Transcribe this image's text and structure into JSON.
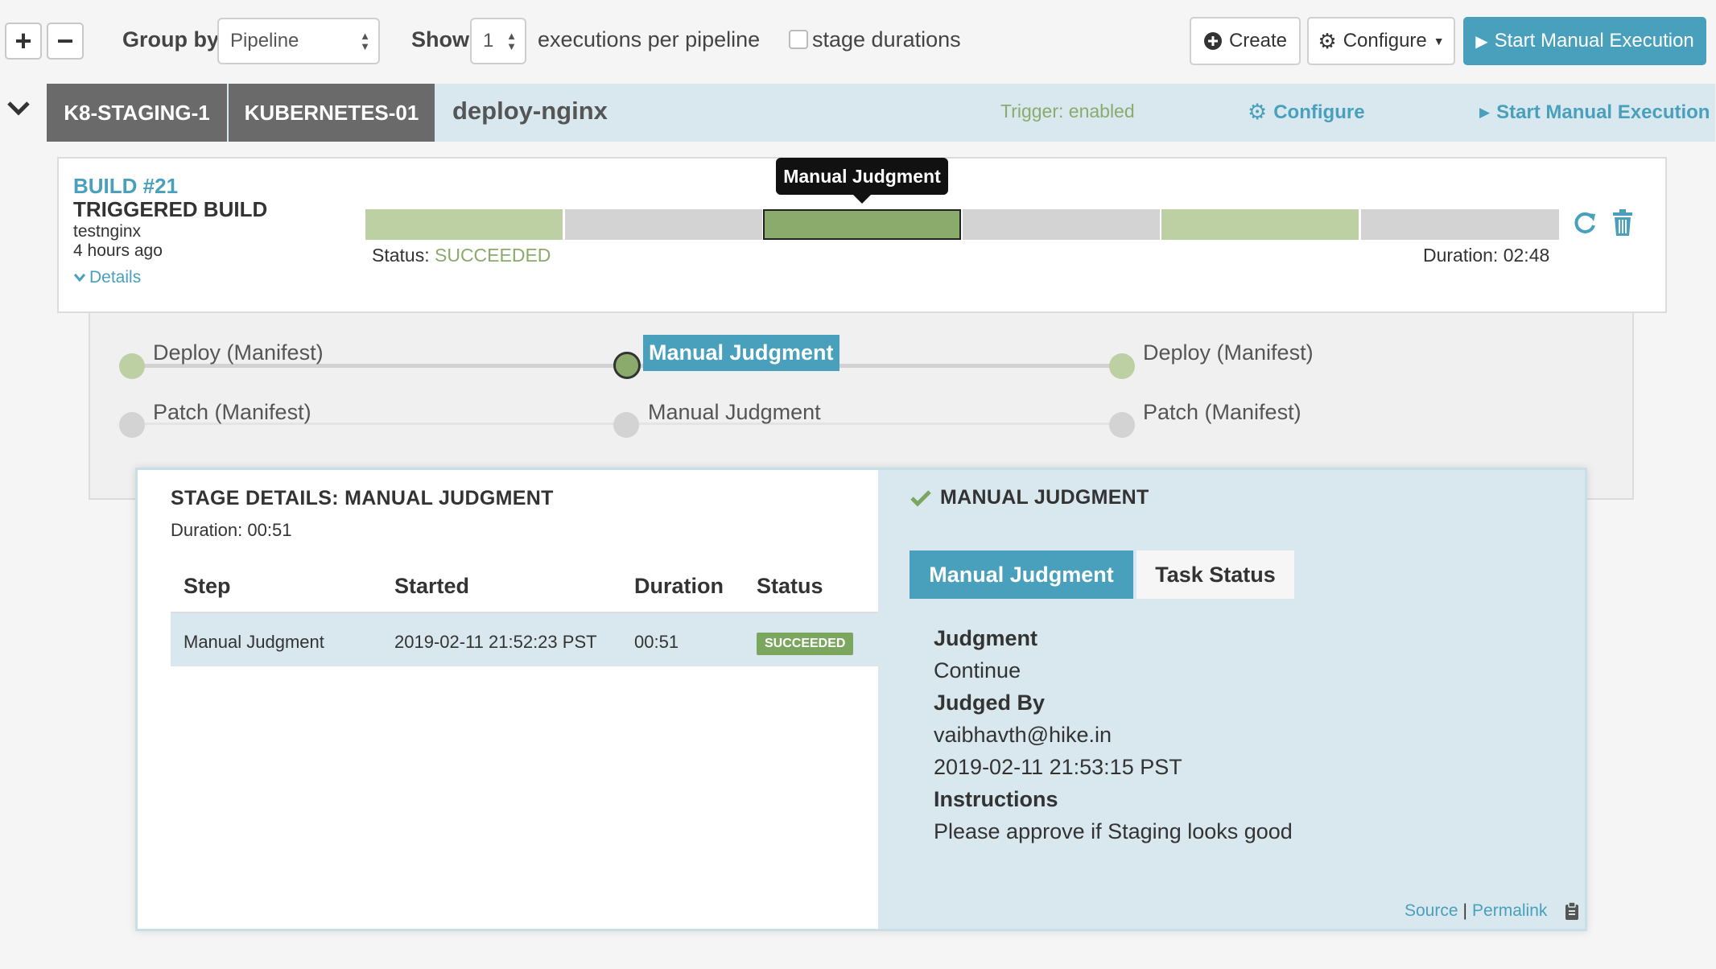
{
  "toolbar": {
    "expand_label": "+",
    "collapse_label": "−",
    "group_by_label": "Group by",
    "group_by_value": "Pipeline",
    "show_label": "Show",
    "show_value": "1",
    "per_pipeline_text": "executions per pipeline",
    "stage_durations_label": "stage durations",
    "create_label": "Create",
    "configure_label": "Configure",
    "start_label": "Start Manual Execution"
  },
  "pipeline": {
    "accounts": [
      "K8-STAGING-1",
      "KUBERNETES-01"
    ],
    "name": "deploy-nginx",
    "trigger_status": "Trigger: enabled",
    "configure_label": "Configure",
    "start_label": "Start Manual Execution"
  },
  "execution": {
    "build": "BUILD #21",
    "trigger": "TRIGGERED BUILD",
    "user": "testnginx",
    "time_ago": "4 hours ago",
    "details_label": "Details",
    "status_label": "Status:",
    "status_value": "SUCCEEDED",
    "duration": "Duration: 02:48",
    "tooltip": "Manual Judgment"
  },
  "stages": {
    "row1": [
      "Deploy (Manifest)",
      "Manual Judgment",
      "Deploy (Manifest)"
    ],
    "row2": [
      "Patch (Manifest)",
      "Manual Judgment",
      "Patch (Manifest)"
    ]
  },
  "stage_details": {
    "title": "STAGE DETAILS: MANUAL JUDGMENT",
    "duration": "Duration: 00:51",
    "columns": [
      "Step",
      "Started",
      "Duration",
      "Status"
    ],
    "rows": [
      {
        "step": "Manual Judgment",
        "started": "2019-02-11 21:52:23 PST",
        "duration": "00:51",
        "status": "SUCCEEDED"
      }
    ]
  },
  "judgment_panel": {
    "title": "MANUAL JUDGMENT",
    "tabs": [
      "Manual Judgment",
      "Task Status"
    ],
    "judgment_label": "Judgment",
    "judgment_value": "Continue",
    "judged_by_label": "Judged By",
    "judged_by_value": "vaibhavth@hike.in",
    "judged_at": "2019-02-11 21:53:15 PST",
    "instructions_label": "Instructions",
    "instructions_value": "Please approve if Staging looks good",
    "source_label": "Source",
    "separator": "|",
    "permalink_label": "Permalink"
  },
  "colors": {
    "accent": "#48a0bd",
    "success": "#8aab6b",
    "success_light": "#bcd0a3",
    "pending": "#d3d3d3"
  }
}
